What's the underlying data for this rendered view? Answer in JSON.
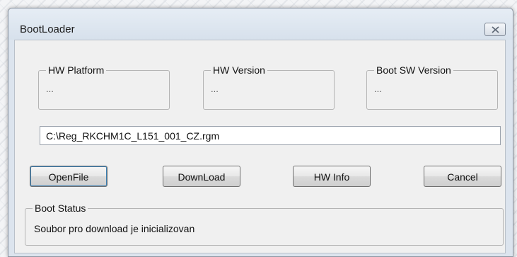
{
  "window": {
    "title": "BootLoader",
    "close_icon": "close-x-icon"
  },
  "groups": {
    "hw_platform": {
      "title": "HW Platform",
      "value": "..."
    },
    "hw_version": {
      "title": "HW Version",
      "value": "..."
    },
    "boot_sw_version": {
      "title": "Boot SW Version",
      "value": "..."
    }
  },
  "file_path": {
    "value": "C:\\Reg_RKCHM1C_L151_001_CZ.rgm"
  },
  "buttons": {
    "open_file": "OpenFile",
    "download": "DownLoad",
    "hw_info": "HW Info",
    "cancel": "Cancel"
  },
  "boot_status": {
    "title": "Boot Status",
    "message": "Soubor pro download je inicializovan"
  }
}
